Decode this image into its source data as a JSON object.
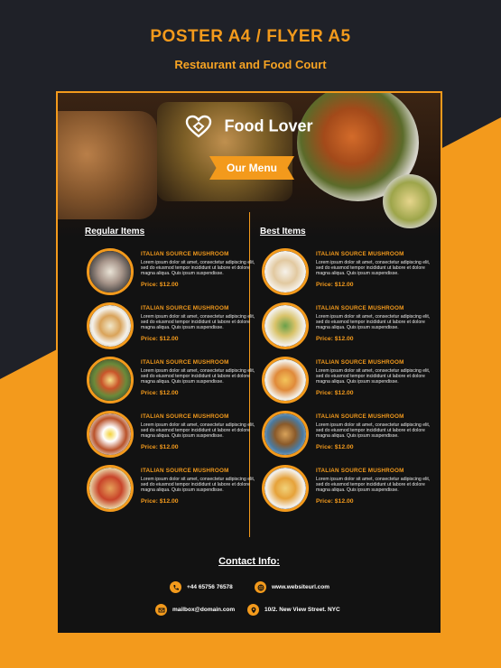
{
  "header": {
    "title": "POSTER A4 / FLYER A5",
    "subtitle": "Restaurant and Food Court"
  },
  "brand": {
    "name": "Food Lover",
    "logo_icon": "heart-icon"
  },
  "menu_label": "Our Menu",
  "columns": {
    "left": {
      "title": "Regular Items",
      "items": [
        {
          "name": "ITALIAN SOURCE MUSHROOM",
          "desc": "Lorem ipsum dolor sit amet, consectetur adipiscing elit, sed do eiusmod tempor incididunt ut labore et dolore magna aliqua. Quis ipsum suspendisse.",
          "price": "Price: $12.00"
        },
        {
          "name": "ITALIAN SOURCE MUSHROOM",
          "desc": "Lorem ipsum dolor sit amet, consectetur adipiscing elit, sed do eiusmod tempor incididunt ut labore et dolore magna aliqua. Quis ipsum suspendisse.",
          "price": "Price: $12.00"
        },
        {
          "name": "ITALIAN SOURCE MUSHROOM",
          "desc": "Lorem ipsum dolor sit amet, consectetur adipiscing elit, sed do eiusmod tempor incididunt ut labore et dolore magna aliqua. Quis ipsum suspendisse.",
          "price": "Price: $12.00"
        },
        {
          "name": "ITALIAN SOURCE MUSHROOM",
          "desc": "Lorem ipsum dolor sit amet, consectetur adipiscing elit, sed do eiusmod tempor incididunt ut labore et dolore magna aliqua. Quis ipsum suspendisse.",
          "price": "Price: $12.00"
        },
        {
          "name": "ITALIAN SOURCE MUSHROOM",
          "desc": "Lorem ipsum dolor sit amet, consectetur adipiscing elit, sed do eiusmod tempor incididunt ut labore et dolore magna aliqua. Quis ipsum suspendisse.",
          "price": "Price: $12.00"
        }
      ]
    },
    "right": {
      "title": "Best Items",
      "items": [
        {
          "name": "ITALIAN SOURCE MUSHROOM",
          "desc": "Lorem ipsum dolor sit amet, consectetur adipiscing elit, sed do eiusmod tempor incididunt ut labore et dolore magna aliqua. Quis ipsum suspendisse.",
          "price": "Price: $12.00"
        },
        {
          "name": "ITALIAN SOURCE MUSHROOM",
          "desc": "Lorem ipsum dolor sit amet, consectetur adipiscing elit, sed do eiusmod tempor incididunt ut labore et dolore magna aliqua. Quis ipsum suspendisse.",
          "price": "Price: $12.00"
        },
        {
          "name": "ITALIAN SOURCE MUSHROOM",
          "desc": "Lorem ipsum dolor sit amet, consectetur adipiscing elit, sed do eiusmod tempor incididunt ut labore et dolore magna aliqua. Quis ipsum suspendisse.",
          "price": "Price: $12.00"
        },
        {
          "name": "ITALIAN SOURCE MUSHROOM",
          "desc": "Lorem ipsum dolor sit amet, consectetur adipiscing elit, sed do eiusmod tempor incididunt ut labore et dolore magna aliqua. Quis ipsum suspendisse.",
          "price": "Price: $12.00"
        },
        {
          "name": "ITALIAN SOURCE MUSHROOM",
          "desc": "Lorem ipsum dolor sit amet, consectetur adipiscing elit, sed do eiusmod tempor incididunt ut labore et dolore magna aliqua. Quis ipsum suspendisse.",
          "price": "Price: $12.00"
        }
      ]
    }
  },
  "contact": {
    "title": "Contact Info:",
    "phone": "+44 65756 76578",
    "website": "www.websiteurl.com",
    "email": "mailbox@domain.com",
    "address": "10/2. New View Street. NYC",
    "icons": [
      "phone-icon",
      "globe-icon",
      "mail-icon",
      "location-icon"
    ]
  },
  "colors": {
    "accent": "#f39a1c",
    "background": "#1f2128",
    "poster": "#121212"
  }
}
